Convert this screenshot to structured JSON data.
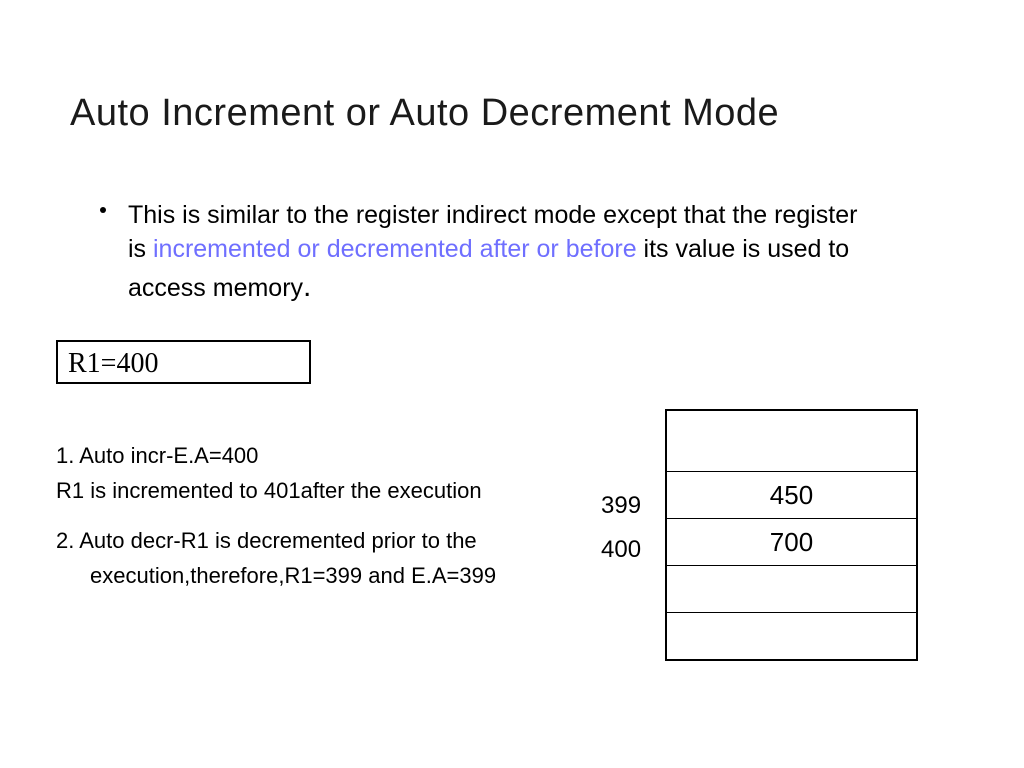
{
  "title": "Auto Increment or Auto  Decrement Mode",
  "bullet": {
    "pre": "This is similar to the register indirect mode except that the register is ",
    "hl": "incremented or decremented after or before",
    "post": " its value is used to access memory"
  },
  "period": ".",
  "register_box": "R1=400",
  "notes": {
    "p1a": "1.  Auto incr-E.A=400",
    "p1b": "R1 is incremented to 401after the execution",
    "p2a": "2. Auto decr-R1 is decremented prior to the",
    "p2b": "execution,therefore,R1=399 and E.A=399"
  },
  "memory": {
    "label_399": "399",
    "label_400": "400",
    "cells": [
      "",
      "450",
      "700",
      "",
      ""
    ]
  }
}
